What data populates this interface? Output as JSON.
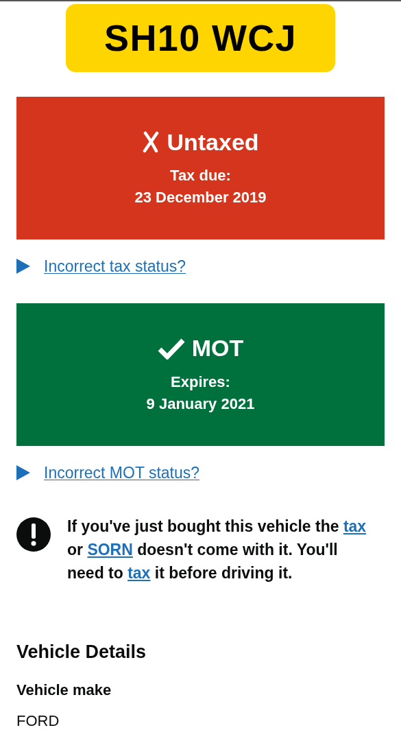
{
  "plate": "SH10 WCJ",
  "statuses": [
    {
      "valid": false,
      "title": "Untaxed",
      "label": "Tax due:",
      "date": "23 December 2019",
      "link": "Incorrect tax status?"
    },
    {
      "valid": true,
      "title": "MOT",
      "label": "Expires:",
      "date": "9 January 2021",
      "link": "Incorrect MOT status?"
    }
  ],
  "warning": [
    {
      "kind": "text",
      "text": "If you've just bought this vehicle the "
    },
    {
      "kind": "link",
      "text": "tax"
    },
    {
      "kind": "text",
      "text": " or "
    },
    {
      "kind": "link",
      "text": "SORN"
    },
    {
      "kind": "text",
      "text": " doesn't come with it. You'll need to "
    },
    {
      "kind": "link",
      "text": "tax"
    },
    {
      "kind": "text",
      "text": " it before driving it."
    }
  ],
  "details": {
    "heading": "Vehicle Details",
    "items": [
      {
        "label": "Vehicle make",
        "value": "FORD"
      }
    ]
  }
}
